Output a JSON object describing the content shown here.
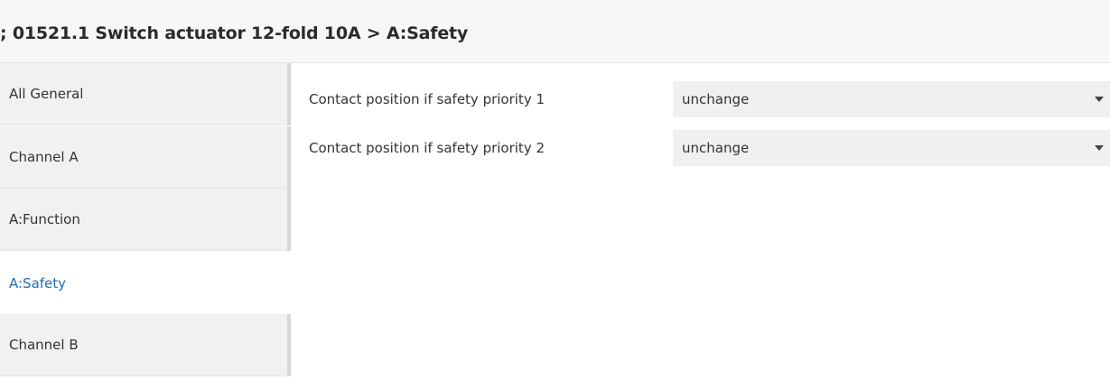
{
  "header": {
    "title": "; 01521.1 Switch actuator 12-fold 10A > A:Safety"
  },
  "sidebar": {
    "items": [
      {
        "label": "All General",
        "active": false
      },
      {
        "label": "Channel A",
        "active": false
      },
      {
        "label": "A:Function",
        "active": false
      },
      {
        "label": "A:Safety",
        "active": true
      },
      {
        "label": "Channel B",
        "active": false
      }
    ]
  },
  "params": [
    {
      "label": "Contact position if safety priority 1",
      "value": "unchange"
    },
    {
      "label": "Contact position if safety priority 2",
      "value": "unchange"
    }
  ],
  "colors": {
    "active_item": "#1f6fb2",
    "sidebar_bg": "#f1f1f1",
    "select_bg": "#f0f0f0"
  }
}
